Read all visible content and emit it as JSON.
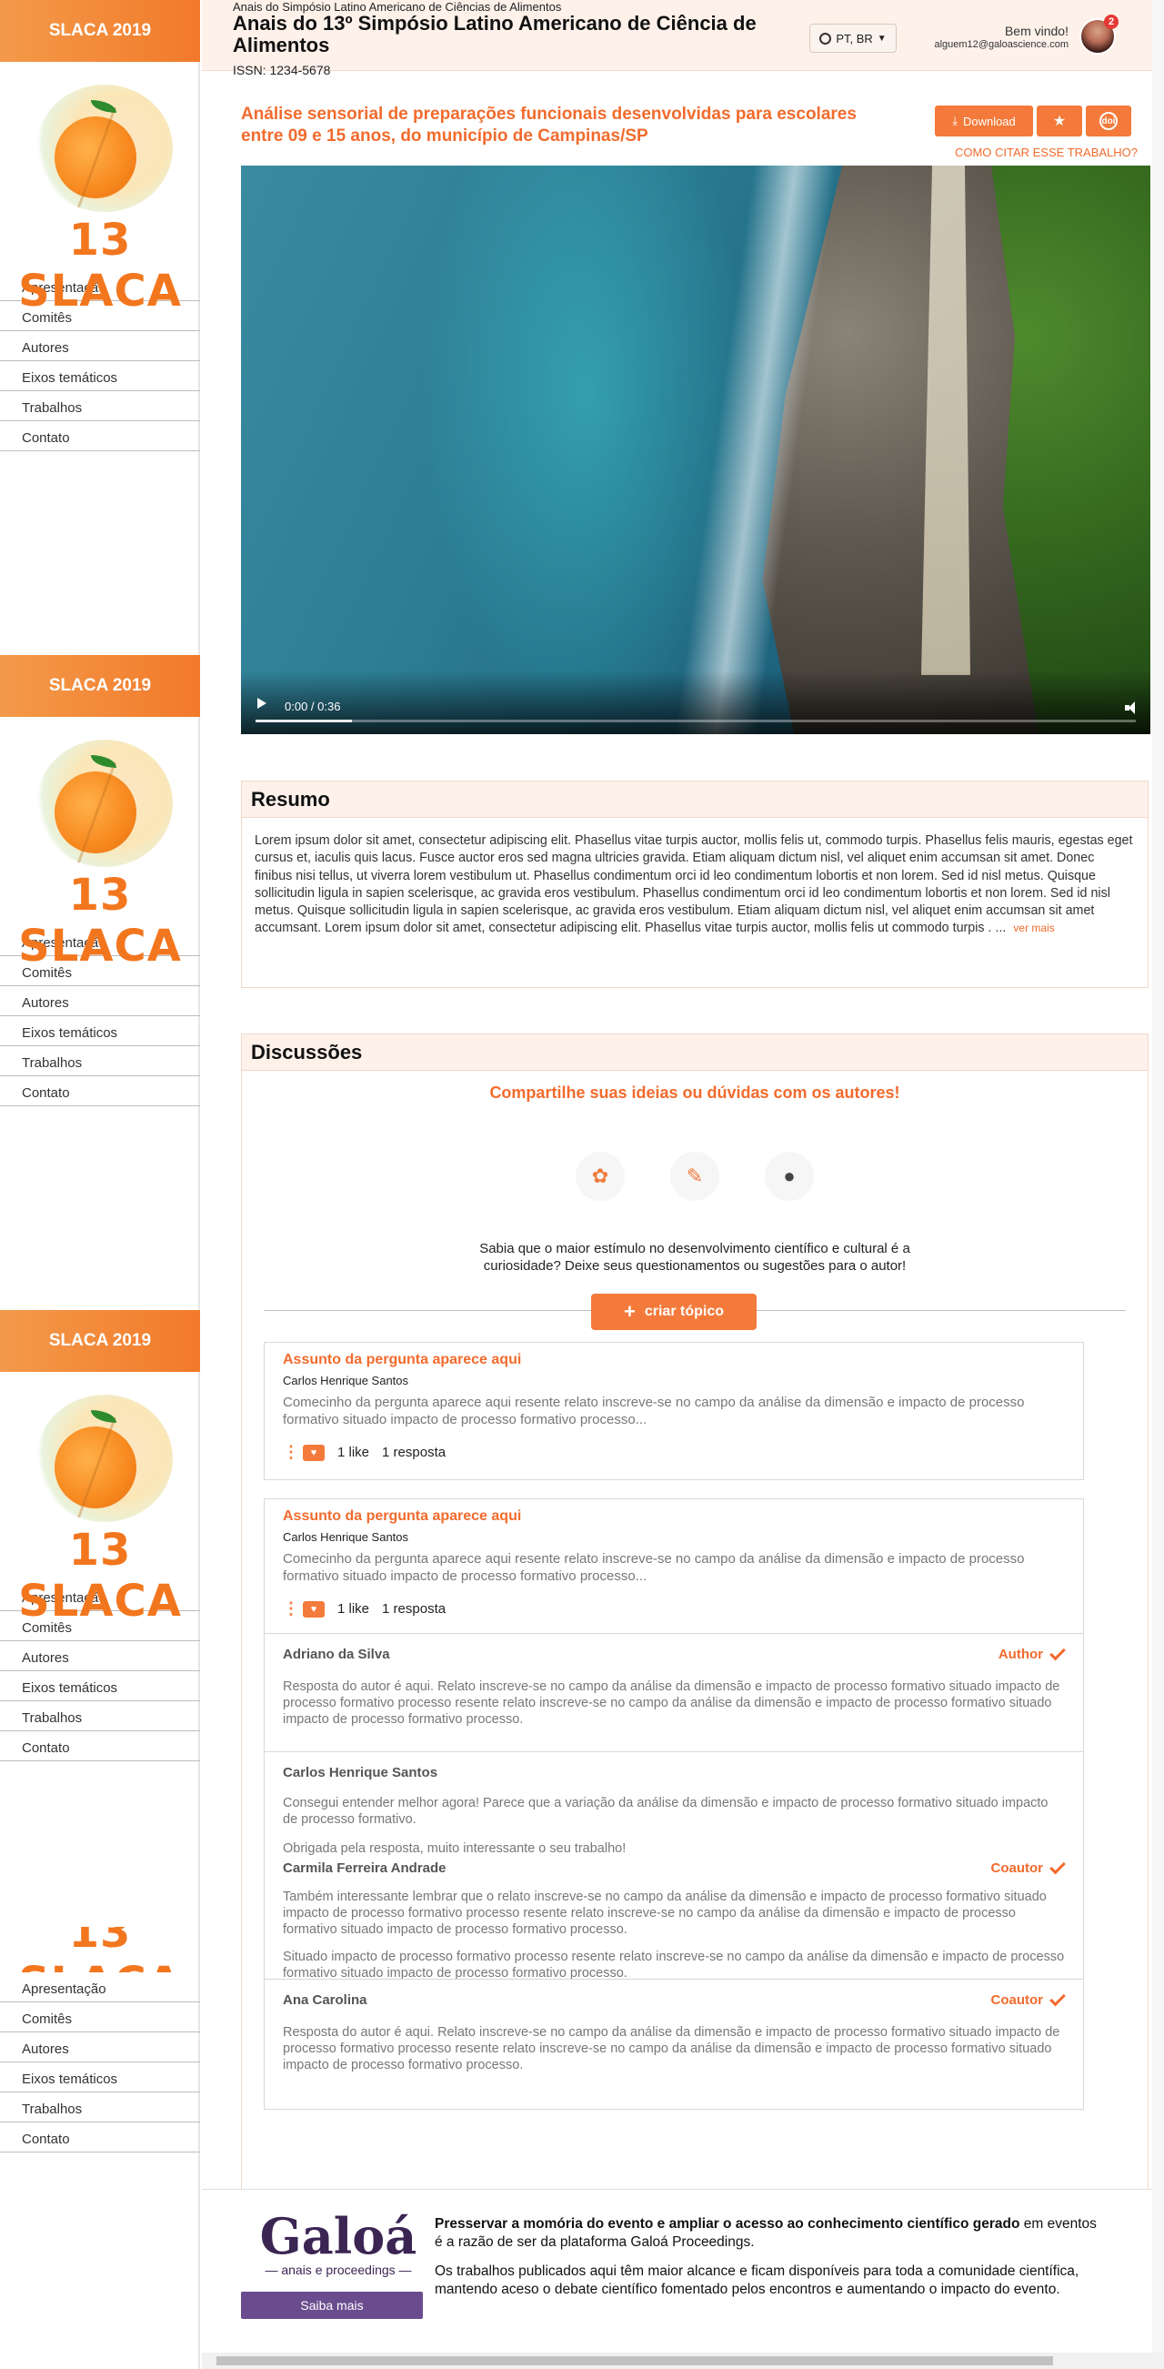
{
  "sidebar": {
    "event_name": "SLACA 2019",
    "logo_text": "13 SLACA",
    "nav": [
      "Apresentação",
      "Comitês",
      "Autores",
      "Eixos temáticos",
      "Trabalhos",
      "Contato"
    ]
  },
  "header": {
    "subtitle": "Anais do Simpósio Latino Americano de Ciências de Alimentos",
    "title": "Anais do 13º Simpósio Latino Americano de Ciência de Alimentos",
    "issn": "ISSN: 1234-5678",
    "language": "PT, BR",
    "welcome": "Bem vindo!",
    "email": "alguem12@galoascience.com",
    "notifications": "2"
  },
  "work": {
    "title": "Análise sensorial de preparações funcionais desenvolvidas para escolares entre 09 e 15 anos, do município de Campinas/SP",
    "download_label": "Download",
    "cite_label": "COMO CITAR ESSE TRABALHO?"
  },
  "video": {
    "time": "0:00 / 0:36",
    "progress_fraction": 0.11
  },
  "resumo": {
    "heading": "Resumo",
    "text": "Lorem ipsum dolor sit amet, consectetur adipiscing elit. Phasellus vitae turpis auctor, mollis felis ut, commodo turpis. Phasellus felis mauris, egestas eget cursus et, iaculis quis lacus. Fusce auctor eros sed magna ultricies gravida. Etiam aliquam dictum nisl, vel aliquet enim accumsan sit amet. Donec finibus nisi tellus, ut viverra lorem vestibulum ut. Phasellus condimentum orci id leo condimentum lobortis et non lorem. Sed id nisl metus. Quisque sollicitudin ligula in sapien scelerisque, ac gravida eros vestibulum. Phasellus condimentum orci id leo condimentum lobortis et non lorem. Sed id nisl metus. Quisque sollicitudin ligula in sapien scelerisque, ac gravida eros vestibulum. Etiam aliquam dictum nisl, vel aliquet enim accumsan sit amet accumsant. Lorem ipsum dolor sit amet, consectetur adipiscing elit. Phasellus vitae turpis auctor, mollis felis ut commodo turpis . ...",
    "more_label": "ver mais"
  },
  "discussions": {
    "heading": "Discussões",
    "cta": "Compartilhe suas ideias ou dúvidas com os autores!",
    "note": "Sabia que o maior estímulo no desenvolvimento científico e cultural é a curiosidade? Deixe seus questionamentos ou sugestões para o autor!",
    "create_label": "criar tópico",
    "topics": [
      {
        "title": "Assunto da pergunta aparece aqui",
        "author": "Carlos Henrique Santos",
        "excerpt": "Comecinho da pergunta aparece aqui resente relato inscreve-se no campo da análise da dimensão e impacto de processo formativo situado impacto de processo formativo processo...",
        "likes": "1 like",
        "replies": "1 resposta"
      },
      {
        "title": "Assunto da pergunta aparece aqui",
        "author": "Carlos Henrique Santos",
        "excerpt": "Comecinho da pergunta aparece aqui resente relato inscreve-se no campo da análise da dimensão e impacto de processo formativo situado impacto de processo formativo processo...",
        "likes": "1 like",
        "replies": "1 resposta",
        "thread": [
          {
            "name": "Adriano da Silva",
            "role": "Author",
            "text": "Resposta do autor é aqui. Relato inscreve-se no campo da análise da dimensão e impacto de processo formativo situado impacto de processo formativo processo resente relato inscreve-se no campo da análise da dimensão e impacto de processo formativo situado impacto de processo formativo processo."
          },
          {
            "name": "Carlos Henrique Santos",
            "role": "",
            "text": "Consegui entender melhor agora! Parece que a variação da análise da dimensão e impacto de processo formativo situado impacto de processo formativo.",
            "text2": "Obrigada pela resposta, muito interessante o seu trabalho!"
          },
          {
            "name": "Carmila Ferreira Andrade",
            "role": "Coautor",
            "text": "Também interessante lembrar que o relato inscreve-se no campo da análise da dimensão e impacto de processo formativo situado impacto de processo formativo processo resente relato inscreve-se no campo da análise da dimensão e impacto de processo formativo situado impacto de processo formativo processo.",
            "text2": "Situado impacto de processo formativo processo resente relato inscreve-se no campo da análise da dimensão e impacto de processo formativo situado impacto de processo formativo processo."
          },
          {
            "name": "Ana Carolina",
            "role": "Coautor",
            "text": "Resposta do autor é aqui. Relato inscreve-se no campo da análise da dimensão e impacto de processo formativo situado impacto de processo formativo processo resente relato inscreve-se no campo da análise da dimensão e impacto de processo formativo situado impacto de processo formativo processo."
          }
        ]
      }
    ]
  },
  "footer": {
    "logo_word": "Galoá",
    "logo_tagline": "— anais e proceedings —",
    "button": "Saiba mais",
    "lead_bold": "Presservar a momória do evento e ampliar o acesso ao conhecimento científico gerado",
    "lead_rest": " em eventos é a razão de ser da plataforma Galoá Proceedings.",
    "paragraph2": "Os trabalhos publicados aqui têm maior alcance e ficam disponíveis para toda a comunidade científica, mantendo aceso o debate científico fomentado pelos encontros e aumentando o impacto do evento."
  },
  "colors": {
    "accent": "#f26b2d",
    "header_bg": "#fdf1ea",
    "brand_purple": "#3b2553"
  }
}
